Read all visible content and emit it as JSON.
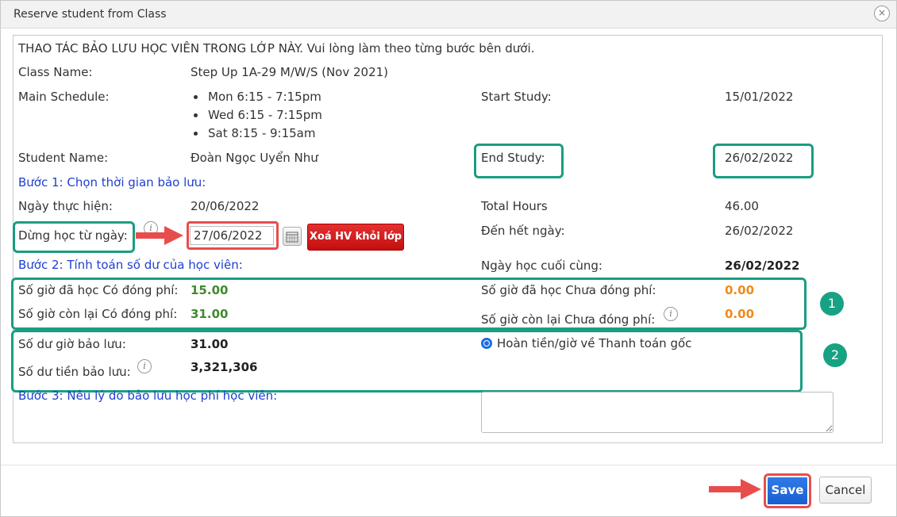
{
  "dialog": {
    "title": "Reserve student from Class",
    "close_glyph": "×"
  },
  "intro": "THAO TÁC BẢO LƯU HỌC VIÊN TRONG LỚP NÀY. Vui lòng làm theo từng bước bên dưới.",
  "class_name": {
    "label": "Class Name:",
    "value": "Step Up 1A-29 M/W/S (Nov 2021)"
  },
  "main_schedule": {
    "label": "Main Schedule:",
    "items": [
      "Mon 6:15 - 7:15pm",
      "Wed 6:15 - 7:15pm",
      "Sat 8:15 - 9:15am"
    ]
  },
  "start_study": {
    "label": "Start Study:",
    "value": "15/01/2022"
  },
  "student_name": {
    "label": "Student Name:",
    "value": "Đoàn Ngọc Uyển Như"
  },
  "end_study": {
    "label": "End Study:",
    "value": "26/02/2022"
  },
  "step1": "Bước 1: Chọn thời gian bảo lưu:",
  "ngay_thuc_hien": {
    "label": "Ngày thực hiện:",
    "value": "20/06/2022"
  },
  "total_hours": {
    "label": "Total Hours",
    "value": "46.00"
  },
  "dung_hoc": {
    "label": "Dừng học từ ngày:",
    "date": "27/06/2022",
    "delete_button": "Xoá HV khỏi lớp"
  },
  "den_het_ngay": {
    "label": "Đến hết ngày:",
    "value": "26/02/2022"
  },
  "step2": "Bước 2: Tính toán số dư của học viên:",
  "ngay_hoc_cuoi": {
    "label": "Ngày học cuối cùng:",
    "value": "26/02/2022"
  },
  "so_gio_da_hoc_co_phi": {
    "label": "Số giờ đã học Có đóng phí:",
    "value": "15.00"
  },
  "so_gio_con_lai_co_phi": {
    "label": "Số giờ còn lại Có đóng phí:",
    "value": "31.00"
  },
  "so_gio_da_hoc_chua_phi": {
    "label": "Số giờ đã học Chưa đóng phí:",
    "value": "0.00"
  },
  "so_gio_con_lai_chua_phi": {
    "label": "Số giờ còn lại Chưa đóng phí:",
    "value": "0.00"
  },
  "so_du_gio": {
    "label": "Số dư giờ bảo lưu:",
    "value": "31.00"
  },
  "so_du_tien": {
    "label": "Số dư tiền bảo lưu:",
    "value": "3,321,306"
  },
  "refund_option": "Hoàn tiền/giờ về Thanh toán gốc",
  "step3": "Bước 3: Nêu lý do bảo lưu học phí học viên:",
  "reason_text": "",
  "badges": [
    "1",
    "2"
  ],
  "info_glyph": "i",
  "footer": {
    "save": "Save",
    "cancel": "Cancel"
  },
  "colors": {
    "highlight": "#1a9d82",
    "arrow": "#e84d4d",
    "step_blue": "#1f3fd1",
    "paid_green": "#3f8a2f",
    "unpaid_orange": "#f08a1c",
    "primary": "#1a5ed0",
    "danger": "#c40f0f"
  }
}
